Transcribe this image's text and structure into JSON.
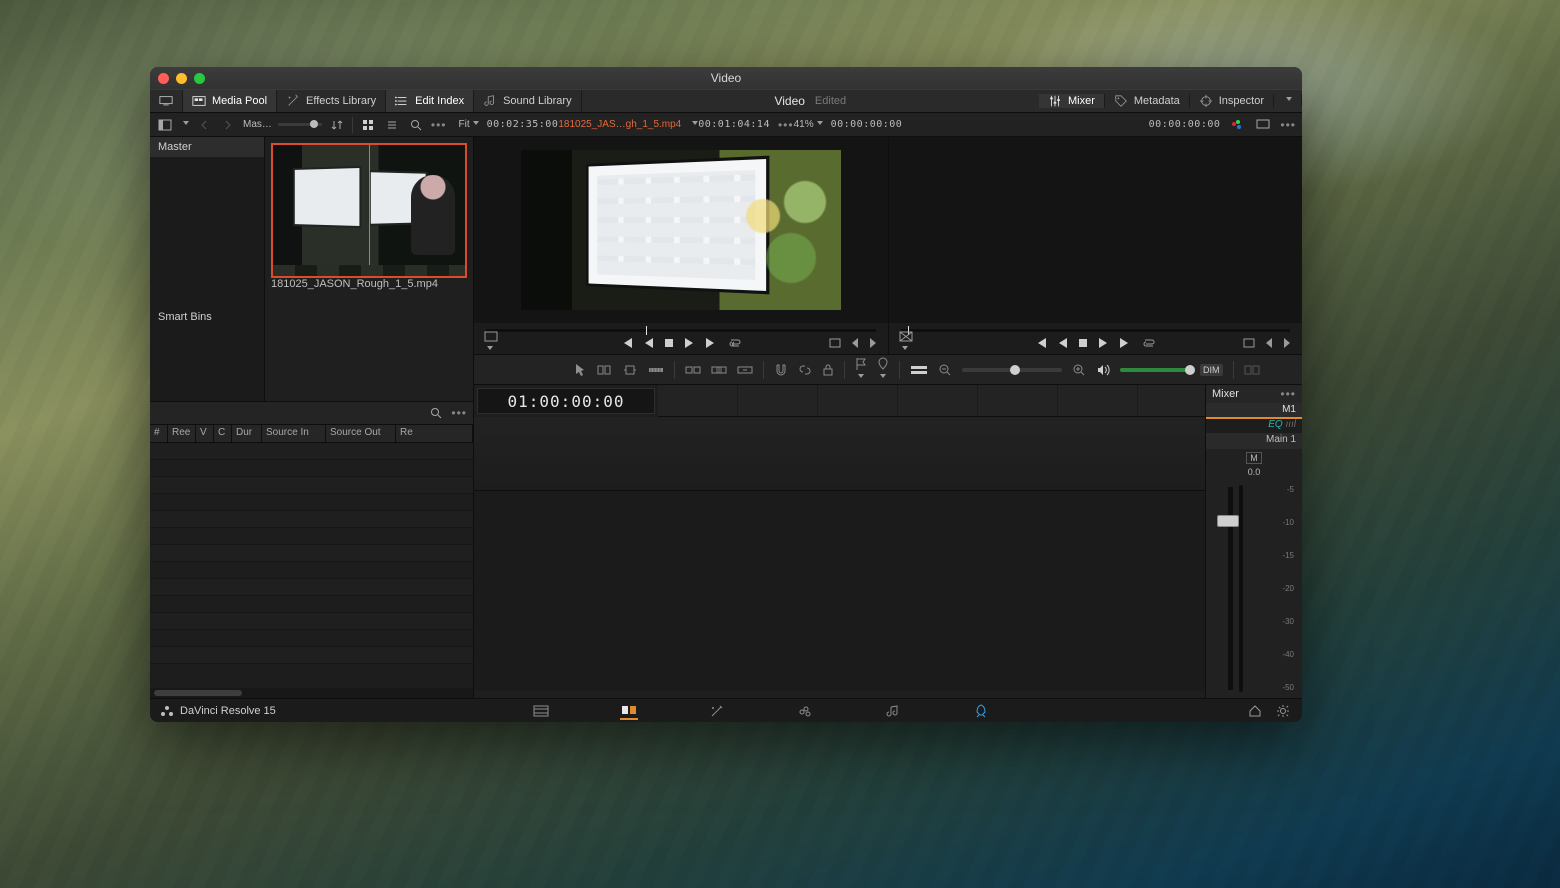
{
  "window": {
    "title": "Video"
  },
  "topbar": {
    "media_pool": "Media Pool",
    "effects_library": "Effects Library",
    "edit_index": "Edit Index",
    "sound_library": "Sound Library",
    "center_title": "Video",
    "center_sub": "Edited",
    "mixer": "Mixer",
    "metadata": "Metadata",
    "inspector": "Inspector"
  },
  "subbar": {
    "bin_label": "Mas…",
    "fit_label": "Fit",
    "src_duration": "00:02:35:00",
    "src_filename": "181025_JAS…gh_1_5.mp4",
    "src_tc": "00:01:04:14",
    "zoom_pct": "41%",
    "tl_tc_left": "00:00:00:00",
    "tl_tc_right": "00:00:00:00"
  },
  "bins": {
    "master": "Master",
    "smart_bins": "Smart Bins"
  },
  "clip": {
    "filename": "181025_JASON_Rough_1_5.mp4"
  },
  "edit_index_cols": [
    "#",
    "Ree",
    "V",
    "C",
    "Dur",
    "Source In",
    "Source Out",
    "Re"
  ],
  "timeline": {
    "tc": "01:00:00:00"
  },
  "mixer": {
    "title": "Mixer",
    "bus": "M1",
    "eq": "EQ",
    "name": "Main 1",
    "mute": "M",
    "db": "0.0",
    "scale": [
      "-5",
      "-10",
      "-15",
      "-20",
      "-30",
      "-40",
      "-50"
    ]
  },
  "toolbar": {
    "dim": "DIM"
  },
  "bottom": {
    "app": "DaVinci Resolve 15"
  }
}
